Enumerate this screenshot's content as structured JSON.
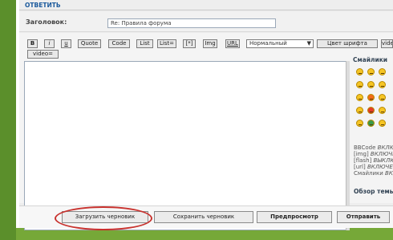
{
  "header": {
    "title": "ОТВЕТИТЬ"
  },
  "subject": {
    "label": "Заголовок:",
    "value": "Re: Правила форума"
  },
  "toolbar": {
    "buttons": [
      "B",
      "i",
      "u",
      "Quote",
      "Code",
      "List",
      "List=",
      "[*]",
      "Img",
      "URL",
      "Цвет шрифта",
      "video",
      "video="
    ],
    "font_size_select": "Нормальный"
  },
  "smilies": {
    "title": "Смайлики",
    "colors": [
      "#f6c524",
      "#f6c524",
      "#f6c524",
      "#f6c524",
      "#f6c524",
      "#f6c524",
      "#f6c524",
      "#f26b1a",
      "#f6c524",
      "#f6c524",
      "#e53b2a",
      "#f6c524",
      "#f6c524",
      "#3a9a4b",
      "#f6c524"
    ]
  },
  "bbinfo": {
    "lines": [
      {
        "label": "BBCode",
        "value": "ВКЛЮЧЕН"
      },
      {
        "label": "[img]",
        "value": "ВКЛЮЧЕН"
      },
      {
        "label": "[flash]",
        "value": "ВЫКЛЮЧЕН"
      },
      {
        "label": "[url]",
        "value": "ВКЛЮЧЕН"
      },
      {
        "label": "Смайлики",
        "value": "ВКЛЮЧЕНЫ"
      }
    ]
  },
  "review": "Обзор темы",
  "buttons": {
    "load_draft": "Загрузить черновик",
    "save_draft": "Сохранить черновик",
    "preview": "Предпросмотр",
    "submit": "Отправить"
  },
  "highlight_color": "#c8322e"
}
